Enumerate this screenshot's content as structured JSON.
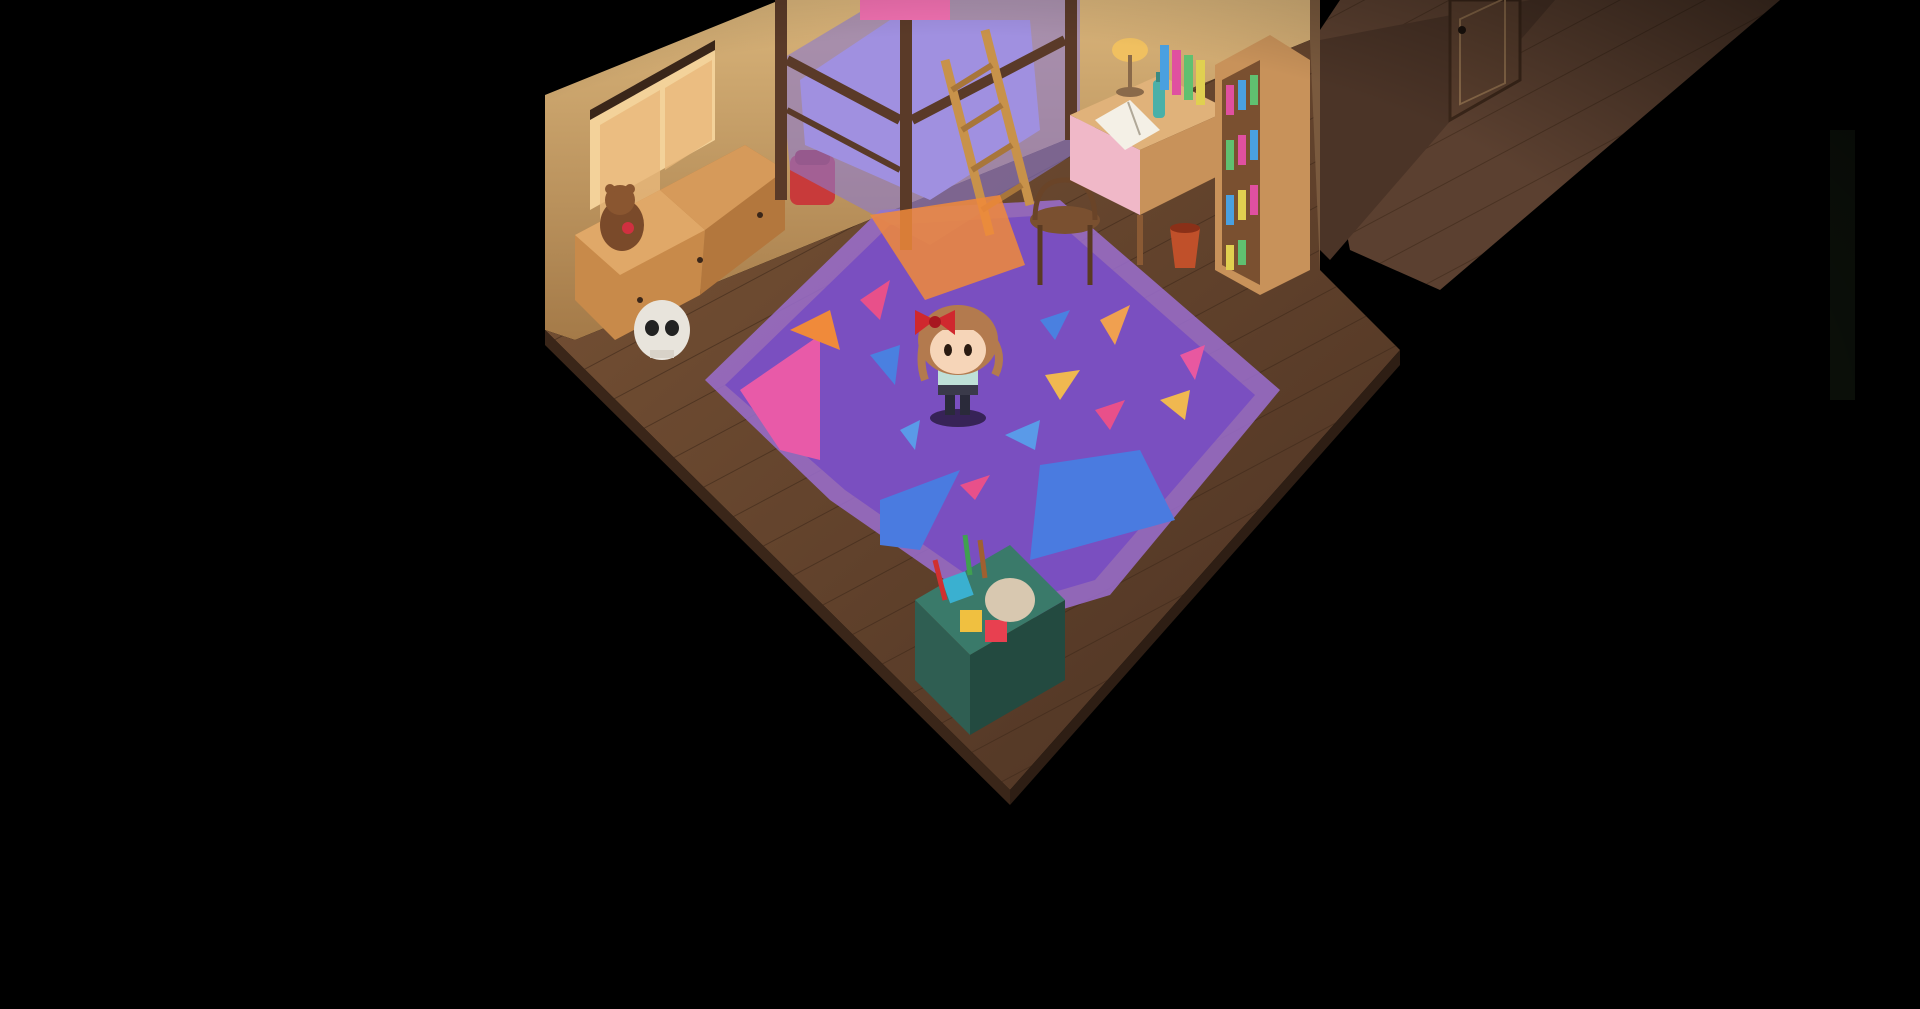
{
  "scene": {
    "name": "bedroom",
    "style": "isometric",
    "lighting": "dark-vignette"
  },
  "player": {
    "character": "girl-with-red-bow",
    "facing": "down"
  },
  "props": [
    "bunk-bed",
    "ladder",
    "curtained-window",
    "dresser",
    "teddy-bear",
    "skull",
    "red-backpack",
    "desk",
    "open-book",
    "desk-lamp",
    "bottle",
    "wooden-chair",
    "bookshelf",
    "trash-bin",
    "toy-box",
    "patterned-rug",
    "door",
    "hallway-floor"
  ],
  "colors": {
    "background": "#000000",
    "rug": "#7a4fc0",
    "rug_border": "#9b6fd0",
    "floor": "#6b4a34",
    "wall": "#c9a06a",
    "toy_box": "#2f5e52",
    "bed_frame": "#5a3a28",
    "player_bow": "#d0282e",
    "player_hair": "#b37a4e"
  }
}
